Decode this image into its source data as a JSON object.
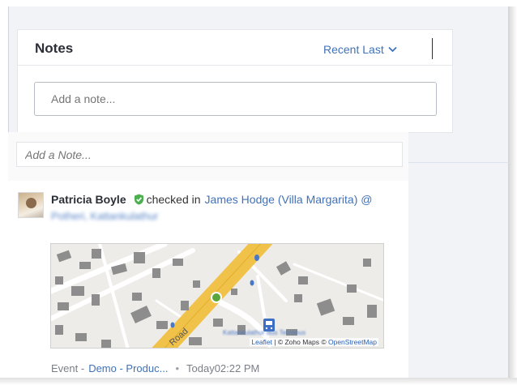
{
  "notes": {
    "title": "Notes",
    "sort_label": "Recent Last",
    "input_placeholder": "Add a note..."
  },
  "timeline": {
    "add_note_placeholder": "Add a Note...",
    "entry": {
      "person": "Patricia Boyle",
      "action": "checked in",
      "location": "James Hodge (Villa Margarita) @",
      "location_detail": "Potheri, Kattankulathur",
      "map": {
        "road_label": "Road",
        "place_label": "Kattankulathur Bus Terminus",
        "attribution_leaflet": "Leaflet",
        "attribution_rest": " | © Zoho Maps © ",
        "attribution_osm": "OpenStreetMap"
      },
      "footer": {
        "type_label": "Event -",
        "event_name": "Demo - Produc...",
        "separator": "•",
        "time": "Today02:22 PM"
      }
    }
  },
  "colors": {
    "accent": "#3f72b8",
    "verified": "#4caf50",
    "road": "#f0c24a",
    "map_bg": "#eeece8",
    "building": "#8d8d8d"
  }
}
